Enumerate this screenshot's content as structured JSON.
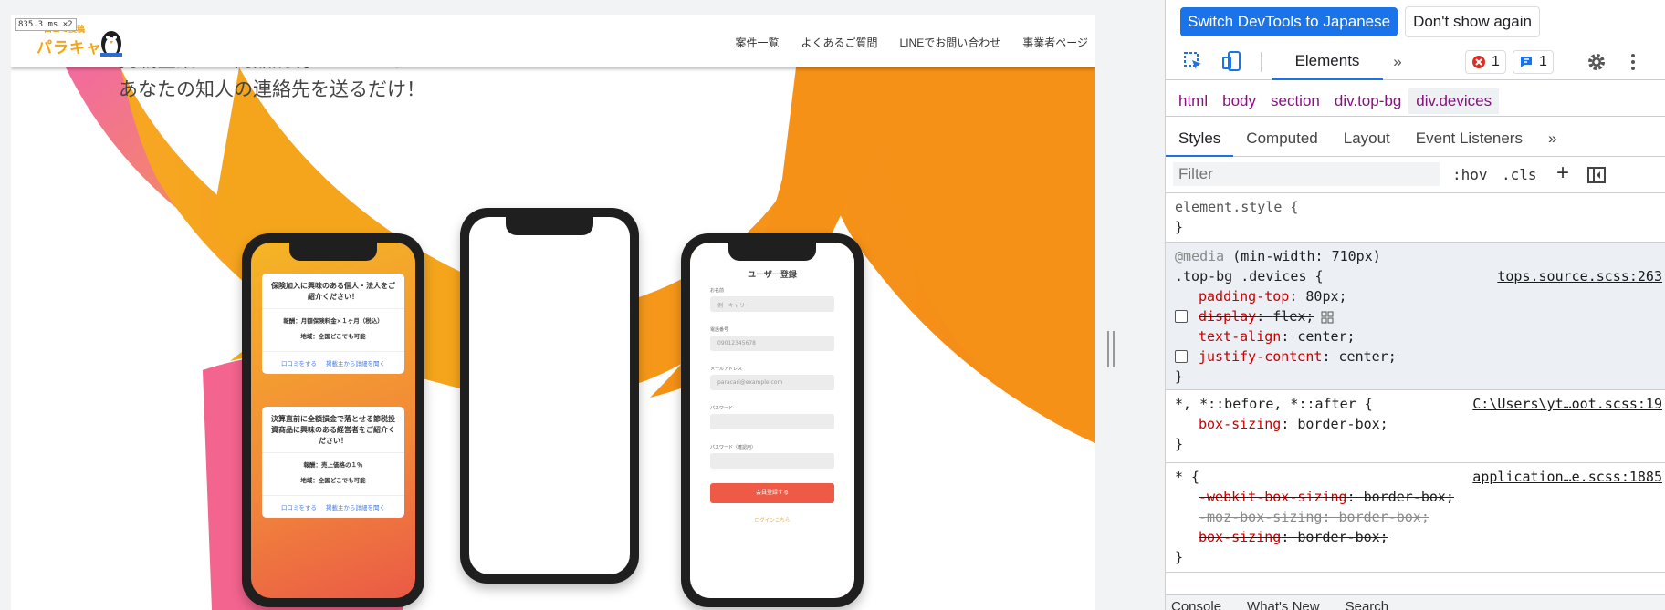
{
  "site": {
    "size_badge": "835.3 ms ×2",
    "logo_top": "口コミ投稿",
    "logo_main": "パラキャリ",
    "nav": [
      "案件一覧",
      "よくあるご質問",
      "LINEでお問い合わせ",
      "事業者ページ"
    ],
    "hero_lines": [
      "掲載企業から商品説明をさいてみたい",
      "あなたの知人の連絡先を送るだけ！"
    ],
    "cards": [
      {
        "title": "保険加入に興味のある個人・法人をご紹介ください！",
        "reward": "報酬：月額保険料金×１ヶ月（税込）",
        "area": "地域：全国どこでも可能",
        "link1": "口コミをする",
        "link2": "掲載主から詳細を聞く"
      },
      {
        "title": "決算直前に全額損金で落とせる節税投資商品に興味のある経営者をご紹介ください！",
        "reward": "報酬：売上価格の１％",
        "area": "地域：全国どこでも可能",
        "link1": "口コミをする",
        "link2": "掲載主から詳細を聞く"
      }
    ],
    "registration": {
      "title": "ユーザー登録",
      "fields": [
        {
          "label": "お名前",
          "placeholder": "例　キャリー"
        },
        {
          "label": "電話番号",
          "placeholder": "09012345678"
        },
        {
          "label": "メールアドレス",
          "placeholder": "paracari@example.com"
        },
        {
          "label": "パスワード",
          "placeholder": ""
        },
        {
          "label": "パスワード（確認用）",
          "placeholder": ""
        }
      ],
      "submit": "会員登録する",
      "login": "ログインこちら"
    },
    "colors": {
      "orange": "#f5a019",
      "pink": "#f06a8a",
      "accent": "#ee5a45"
    }
  },
  "devtools": {
    "lang_banner": {
      "switch": "Switch DevTools to Japanese",
      "dismiss": "Don't show again"
    },
    "tabs": {
      "elements": "Elements",
      "more": "»"
    },
    "error_count": "1",
    "message_count": "1",
    "breadcrumbs": [
      "html",
      "body",
      "section",
      "div.top-bg",
      "div.devices"
    ],
    "subtabs": [
      "Styles",
      "Computed",
      "Layout",
      "Event Listeners",
      "»"
    ],
    "filter_placeholder": "Filter",
    "hov": ":hov",
    "cls": ".cls",
    "rules": {
      "element_style": {
        "selector": "element.style {",
        "close": "}"
      },
      "media": {
        "query_at": "@media",
        "query": " (min-width: 710px)",
        "selector": ".top-bg .devices {",
        "source": "tops.source.scss:263",
        "decls": [
          {
            "prop": "padding-top",
            "val": "80px;"
          },
          {
            "prop": "display",
            "val": "flex;"
          },
          {
            "prop": "text-align",
            "val": "center;"
          },
          {
            "prop": "justify-content",
            "val": "center;"
          }
        ],
        "close": "}"
      },
      "universal_pseudo": {
        "selector": "*, *::before, *::after {",
        "source": "C:\\Users\\yt…oot.scss:19",
        "decls": [
          {
            "prop": "box-sizing",
            "val": "border-box;"
          }
        ],
        "close": "}"
      },
      "universal": {
        "selector": "* {",
        "source": "application…e.scss:1885",
        "decls": [
          {
            "prop": "-webkit-box-sizing",
            "val": "border-box;"
          },
          {
            "prop": "-moz-box-sizing",
            "val": "border-box;"
          },
          {
            "prop": "box-sizing",
            "val": "border-box;"
          }
        ],
        "close": "}"
      }
    },
    "drawer_tabs": [
      "Console",
      "What's New",
      "Search"
    ]
  }
}
